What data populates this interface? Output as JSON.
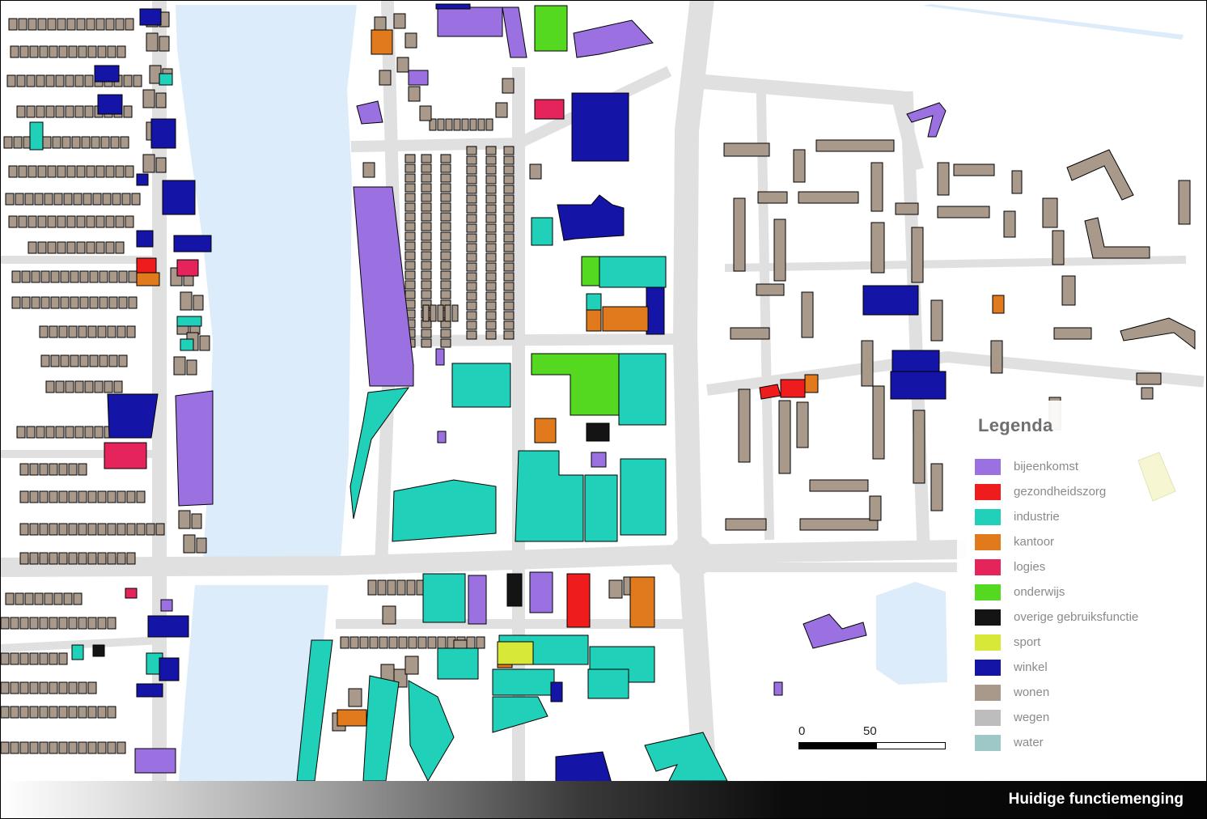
{
  "footer": {
    "title": "Huidige functiemenging"
  },
  "legend": {
    "title": "Legenda",
    "items": [
      {
        "label": "bijeenkomst",
        "color": "#9b70e0"
      },
      {
        "label": "gezondheidszorg",
        "color": "#ee1c1c"
      },
      {
        "label": "industrie",
        "color": "#20d0b8"
      },
      {
        "label": "kantoor",
        "color": "#e07a1c"
      },
      {
        "label": "logies",
        "color": "#e6245c"
      },
      {
        "label": "onderwijs",
        "color": "#54d920"
      },
      {
        "label": "overige gebruiksfunctie",
        "color": "#141414"
      },
      {
        "label": "sport",
        "color": "#d8e838"
      },
      {
        "label": "winkel",
        "color": "#1414a6"
      },
      {
        "label": "wonen",
        "color": "#a8998a"
      },
      {
        "label": "wegen",
        "color": "#bdbdbd"
      },
      {
        "label": "water",
        "color": "#9ec8c8"
      }
    ]
  },
  "scale": {
    "start_label": "0",
    "mid_label": "50"
  },
  "map": {
    "road_color": "#e0e0e0",
    "water_color": "#dcecfa"
  }
}
